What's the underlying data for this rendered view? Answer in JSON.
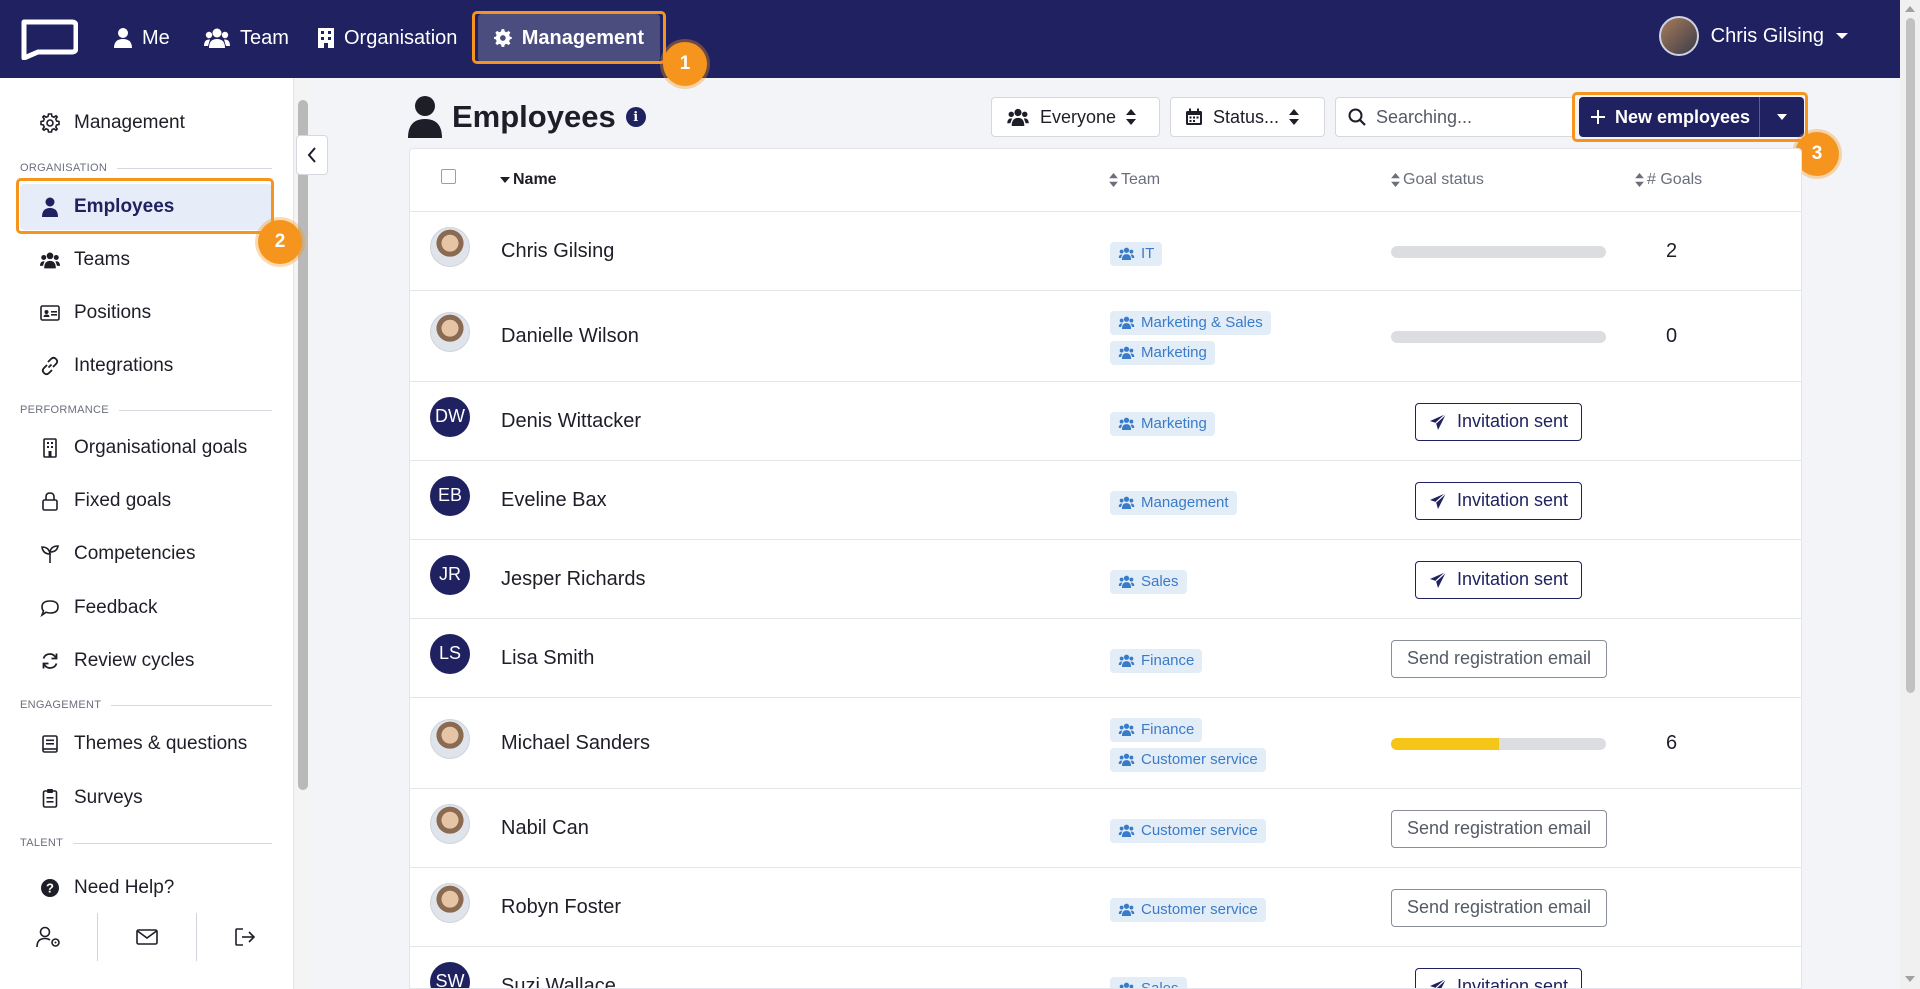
{
  "topnav": {
    "items": [
      {
        "label": "Me",
        "icon": "user-icon"
      },
      {
        "label": "Team",
        "icon": "users-icon"
      },
      {
        "label": "Organisation",
        "icon": "building-icon"
      },
      {
        "label": "Management",
        "icon": "gear-icon",
        "active": true
      }
    ],
    "user_name": "Chris Gilsing"
  },
  "annotations": [
    "1",
    "2",
    "3"
  ],
  "sidebar": {
    "top_item": "Management",
    "sections": {
      "organisation": "ORGANISATION",
      "performance": "PERFORMANCE",
      "engagement": "ENGAGEMENT",
      "talent": "TALENT"
    },
    "items": {
      "employees": "Employees",
      "teams": "Teams",
      "positions": "Positions",
      "integrations": "Integrations",
      "org_goals": "Organisational goals",
      "fixed_goals": "Fixed goals",
      "competencies": "Competencies",
      "feedback": "Feedback",
      "review_cycles": "Review cycles",
      "themes": "Themes & questions",
      "surveys": "Surveys",
      "help": "Need Help?"
    }
  },
  "main": {
    "title": "Employees",
    "info_icon": "i",
    "filters": {
      "everyone": "Everyone",
      "status": "Status..."
    },
    "search_placeholder": "Searching...",
    "new_button": "New employees",
    "columns": {
      "name": "Name",
      "team": "Team",
      "goal_status": "Goal status",
      "goals": "# Goals"
    }
  },
  "colors": {
    "navy": "#1f2160",
    "accent_orange": "#f5951d",
    "tag_blue": "#3a7bc8",
    "progress_yellow": "#f5c518"
  },
  "employees": [
    {
      "name": "Chris Gilsing",
      "initials": "",
      "teams": [
        "IT"
      ],
      "status": "progress",
      "progress": 0,
      "goals": "2"
    },
    {
      "name": "Danielle Wilson",
      "initials": "",
      "teams": [
        "Marketing & Sales",
        "Marketing"
      ],
      "status": "progress",
      "progress": 0,
      "goals": "0"
    },
    {
      "name": "Denis Wittacker",
      "initials": "DW",
      "teams": [
        "Marketing"
      ],
      "status": "invitation",
      "action": "Invitation sent"
    },
    {
      "name": "Eveline Bax",
      "initials": "EB",
      "teams": [
        "Management"
      ],
      "status": "invitation",
      "action": "Invitation sent"
    },
    {
      "name": "Jesper Richards",
      "initials": "JR",
      "teams": [
        "Sales"
      ],
      "status": "invitation",
      "action": "Invitation sent"
    },
    {
      "name": "Lisa Smith",
      "initials": "LS",
      "teams": [
        "Finance"
      ],
      "status": "registration",
      "action": "Send registration email"
    },
    {
      "name": "Michael Sanders",
      "initials": "",
      "teams": [
        "Finance",
        "Customer service"
      ],
      "status": "progress",
      "progress": 0.5,
      "goals": "6"
    },
    {
      "name": "Nabil Can",
      "initials": "",
      "teams": [
        "Customer service"
      ],
      "status": "registration",
      "action": "Send registration email"
    },
    {
      "name": "Robyn Foster",
      "initials": "",
      "teams": [
        "Customer service"
      ],
      "status": "registration",
      "action": "Send registration email"
    },
    {
      "name": "Suzi Wallace",
      "initials": "SW",
      "teams": [
        "Sales"
      ],
      "status": "invitation",
      "action": "Invitation sent"
    }
  ]
}
